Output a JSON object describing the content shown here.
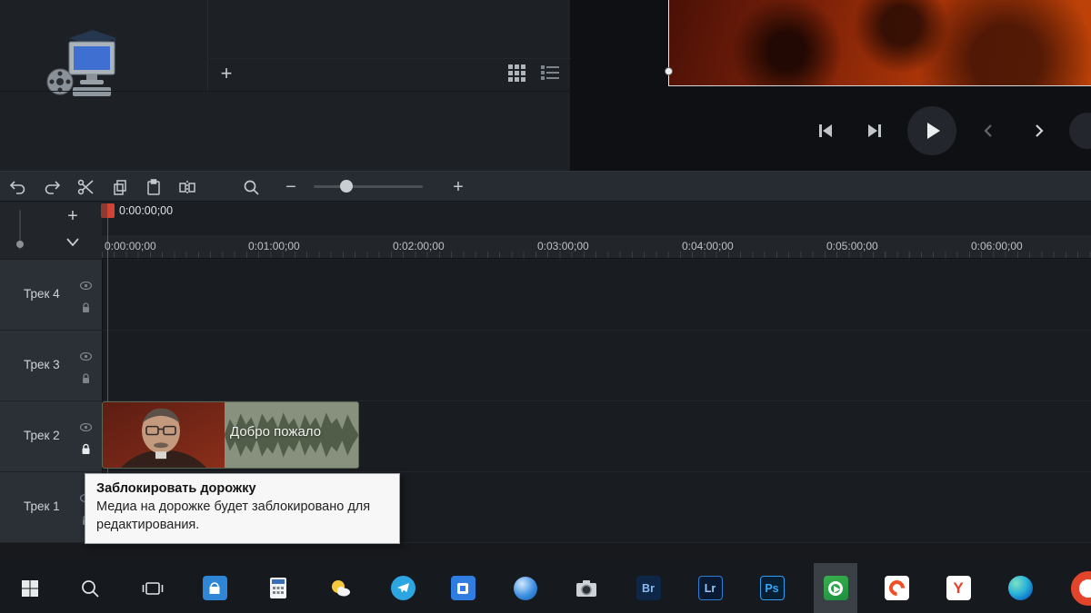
{
  "media_panel": {
    "add_button": "+"
  },
  "toolbar": {
    "zoom_out": "−",
    "zoom_in": "+"
  },
  "timeline": {
    "playhead_time": "0:00:00;00",
    "add_track_button": "+",
    "ruler_labels": [
      "0:00:00;00",
      "0:01:00;00",
      "0:02:00;00",
      "0:03:00;00",
      "0:04:00;00",
      "0:05:00;00",
      "0:06:00;00"
    ],
    "tracks": [
      {
        "name": "Трек 4"
      },
      {
        "name": "Трек 3"
      },
      {
        "name": "Трек 2"
      },
      {
        "name": "Трек 1"
      }
    ],
    "clip": {
      "label": "Добро пожало"
    }
  },
  "tooltip": {
    "title": "Заблокировать дорожку",
    "body": "Медиа на дорожке будет заблокировано для редактирования."
  },
  "taskbar": {
    "bridge": "Br",
    "lightroom": "Lr",
    "photoshop": "Ps",
    "yandex": "Y"
  },
  "colors": {
    "camtasia_green": "#2aa24e",
    "clip_fill": "#87917e",
    "video_orange": "#a83408",
    "tooltip_bg": "#f7f7f7"
  }
}
